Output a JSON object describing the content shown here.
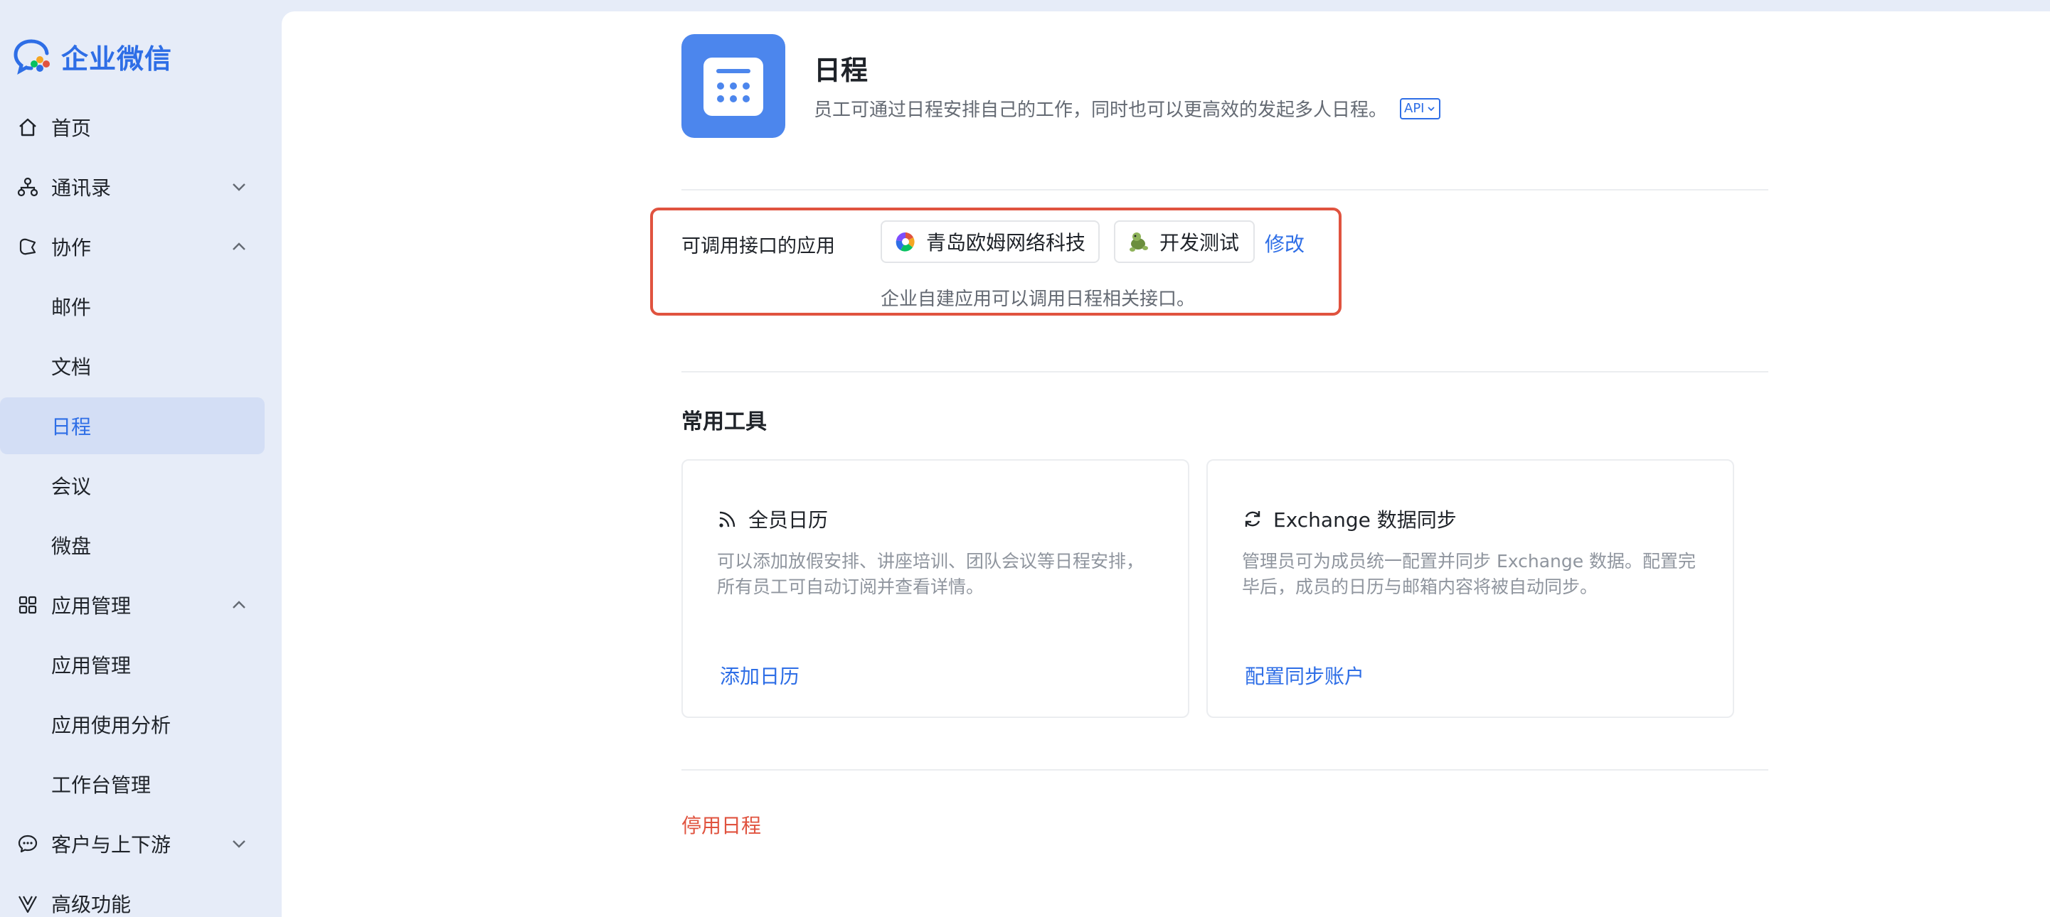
{
  "brand": {
    "name": "企业微信",
    "accent": "#2e6ee6"
  },
  "sidebar": {
    "items": [
      {
        "label": "首页",
        "icon": "home-icon"
      },
      {
        "label": "通讯录",
        "icon": "org-icon",
        "chevron": "down"
      },
      {
        "label": "协作",
        "icon": "collab-icon",
        "chevron": "up"
      },
      {
        "label": "邮件"
      },
      {
        "label": "文档"
      },
      {
        "label": "日程",
        "active": true
      },
      {
        "label": "会议"
      },
      {
        "label": "微盘"
      },
      {
        "label": "应用管理",
        "icon": "grid-icon",
        "chevron": "up"
      },
      {
        "label": "应用管理"
      },
      {
        "label": "应用使用分析"
      },
      {
        "label": "工作台管理"
      },
      {
        "label": "客户与上下游",
        "icon": "chat-bubble-icon",
        "chevron": "down"
      },
      {
        "label": "高级功能",
        "icon": "advanced-icon"
      }
    ]
  },
  "app": {
    "title": "日程",
    "description": "员工可通过日程安排自己的工作，同时也可以更高效的发起多人日程。",
    "api_badge": "API",
    "icon_color": "#4c86ed"
  },
  "callable": {
    "label": "可调用接口的应用",
    "apps": [
      {
        "name": "青岛欧姆网络科技",
        "icon": "pinwheel-icon"
      },
      {
        "name": "开发测试",
        "icon": "turtle-icon"
      }
    ],
    "modify_label": "修改",
    "note": "企业自建应用可以调用日程相关接口。",
    "highlight_color": "#e0533f"
  },
  "tools": {
    "title": "常用工具",
    "cards": [
      {
        "title": "全员日历",
        "icon": "rss-icon",
        "description": "可以添加放假安排、讲座培训、团队会议等日程安排，所有员工可自动订阅并查看详情。",
        "action": "添加日历"
      },
      {
        "title": "Exchange 数据同步",
        "icon": "sync-icon",
        "description": "管理员可为成员统一配置并同步 Exchange 数据。配置完毕后，成员的日历与邮箱内容将被自动同步。",
        "action": "配置同步账户"
      }
    ]
  },
  "disable_label": "停用日程"
}
